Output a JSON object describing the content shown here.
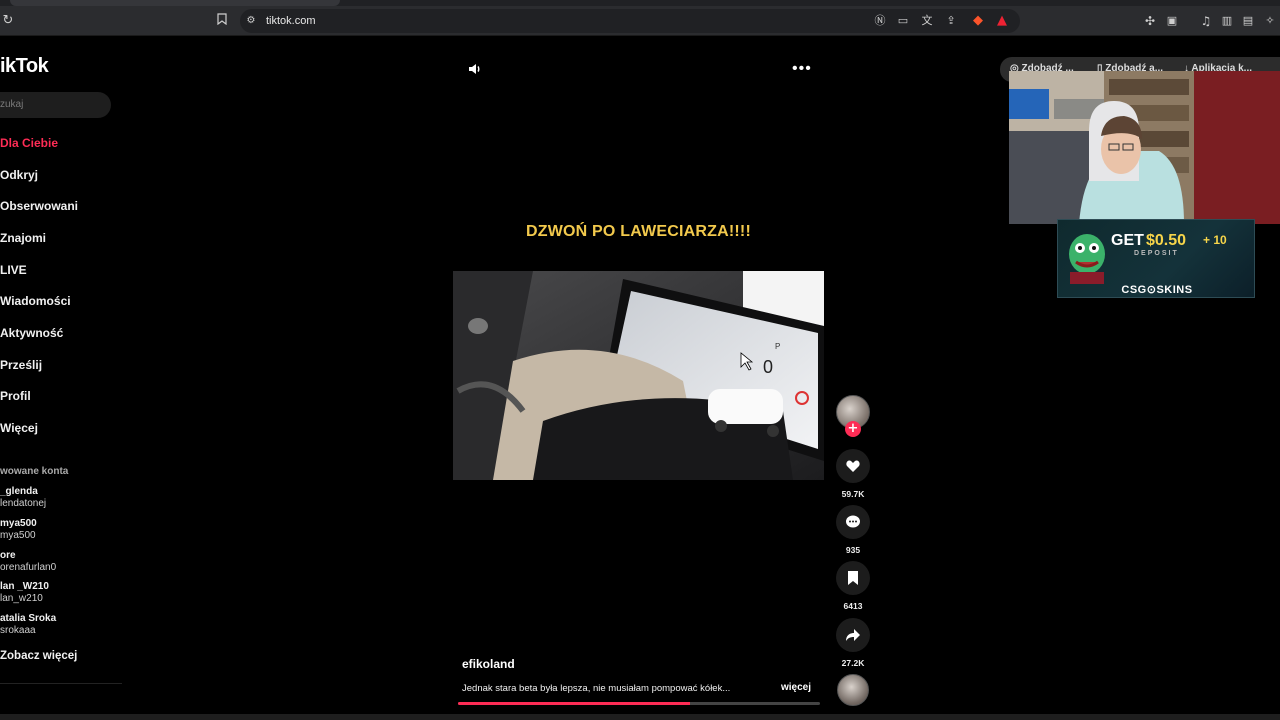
{
  "browser": {
    "url": "tiktok.com",
    "icons": [
      "reload-icon",
      "bookmark-icon",
      "site-info-icon",
      "no-sound-icon",
      "cast-icon",
      "translate-icon",
      "share-icon",
      "brave-icon",
      "alert-icon",
      "extensions-icon",
      "tab-search-icon",
      "music-icon",
      "sidebar-icon",
      "wallet-icon",
      "leo-icon"
    ]
  },
  "sidebar": {
    "logo": "ikTok",
    "search_placeholder": "zukaj",
    "nav": [
      {
        "label": "Dla Ciebie",
        "active": true
      },
      {
        "label": "Odkryj"
      },
      {
        "label": "Obserwowani"
      },
      {
        "label": "Znajomi"
      },
      {
        "label": "LIVE"
      },
      {
        "label": "Wiadomości"
      },
      {
        "label": "Aktywność"
      },
      {
        "label": "Prześlij"
      },
      {
        "label": "Profil"
      },
      {
        "label": "Więcej"
      }
    ],
    "accounts_title": "wowane konta",
    "accounts": [
      {
        "name": "_glenda",
        "handle": "lendatonej"
      },
      {
        "name": "mya500",
        "handle": "mya500"
      },
      {
        "name": "ore",
        "handle": "orenafurlan0"
      },
      {
        "name": "lan _W210",
        "handle": "lan_w210"
      },
      {
        "name": "atalia Sroka",
        "handle": "srokaaa"
      }
    ],
    "see_more": "Zobacz więcej"
  },
  "video": {
    "caption": "DZWOŃ PO LAWECIARZA!!!!",
    "author": "efikoland",
    "description": "Jednak stara beta była lepsza, nie musiałam pompować kółek...",
    "more_label": "więcej",
    "progress": 0.64,
    "dashboard_speed": "0",
    "dashboard_gear": "P",
    "more_icon": "•••"
  },
  "actions": {
    "likes": "59.7K",
    "comments": "935",
    "saves": "6413",
    "shares": "27.2K"
  },
  "overlay": {
    "pills": [
      "Zdobadź ...",
      "Zdobadź a...",
      "Aplikacja k..."
    ],
    "ad": {
      "get": "GET",
      "amount": "$0.50",
      "plus": "+ 10",
      "deposit": "DEPOSIT",
      "brand": "CSG⊙SKINS"
    }
  },
  "colors": {
    "accent": "#fe2c55",
    "caption": "#f2c94c"
  }
}
